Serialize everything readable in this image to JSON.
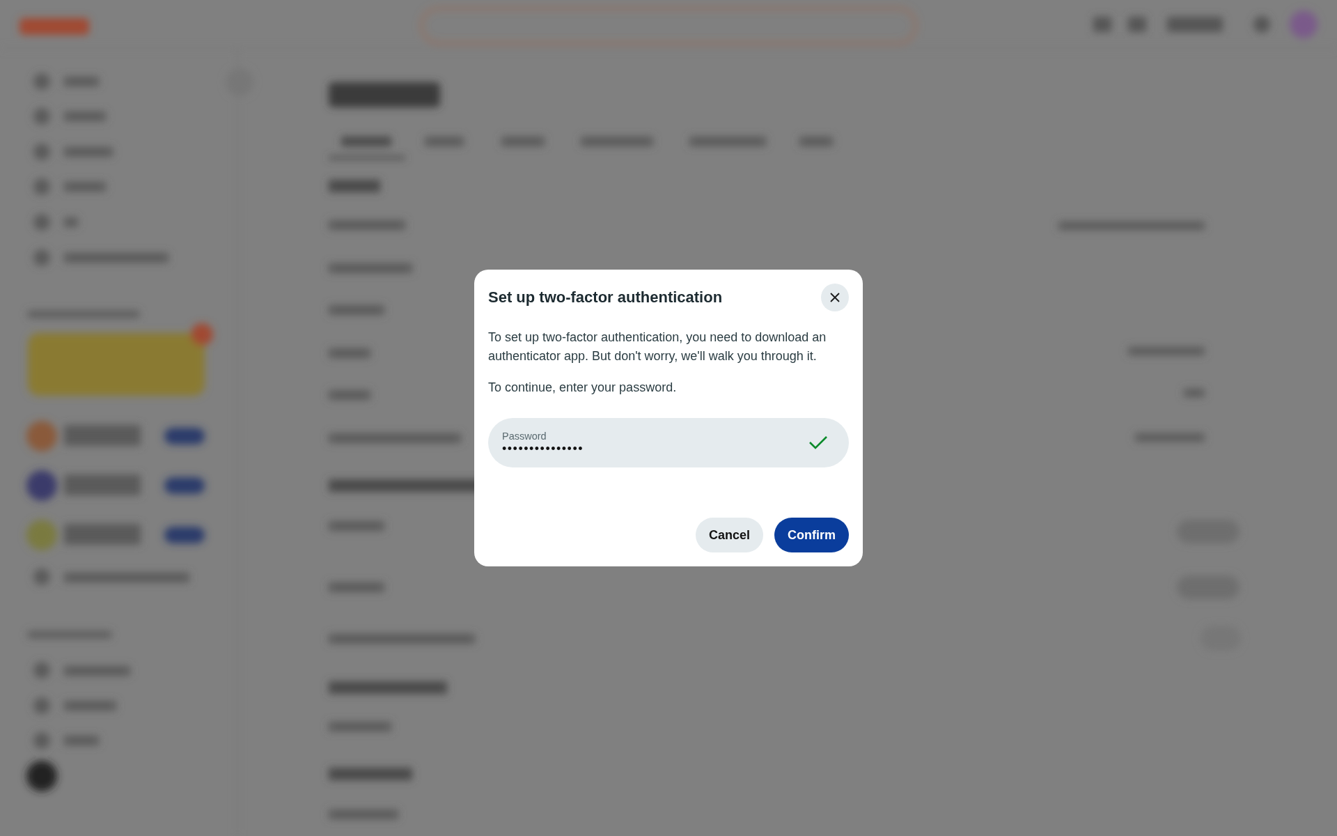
{
  "dialog": {
    "title": "Set up two-factor authentication",
    "paragraphs": [
      "To set up two-factor authentication, you need to download an authenticator app. But don't worry, we'll walk you through it.",
      "To continue, enter your password."
    ],
    "password_field": {
      "label": "Password",
      "value": "•••••••••••••••",
      "valid": true
    },
    "buttons": [
      {
        "label": "Cancel",
        "kind": "secondary"
      },
      {
        "label": "Confirm",
        "kind": "primary"
      }
    ]
  }
}
